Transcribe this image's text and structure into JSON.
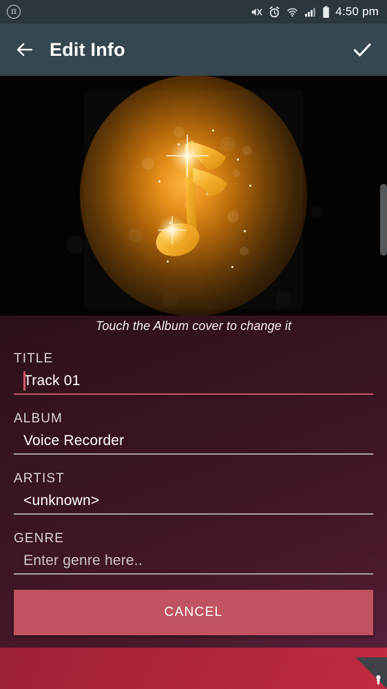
{
  "statusbar": {
    "left_icon": "pi-circle-icon",
    "pi_glyph": "π",
    "icons": [
      "mute-icon",
      "alarm-icon",
      "wifi-icon",
      "signal-icon",
      "battery-icon"
    ],
    "time": "4:50 pm"
  },
  "appbar": {
    "back_icon": "back-arrow-icon",
    "title": "Edit Info",
    "confirm_icon": "checkmark-icon"
  },
  "albumart": {
    "description": "glowing-music-note-album-cover",
    "hint": "Touch the Album cover to change it"
  },
  "form": {
    "fields": [
      {
        "label": "TITLE",
        "value": "Track 01",
        "placeholder": "",
        "focused": true,
        "is_placeholder": false
      },
      {
        "label": "ALBUM",
        "value": "Voice Recorder",
        "placeholder": "",
        "focused": false,
        "is_placeholder": false
      },
      {
        "label": "ARTIST",
        "value": "<unknown>",
        "placeholder": "",
        "focused": false,
        "is_placeholder": false
      },
      {
        "label": "GENRE",
        "value": "Enter genre here..",
        "placeholder": "Enter genre here..",
        "focused": false,
        "is_placeholder": true
      }
    ],
    "cancel_label": "CANCEL"
  },
  "bottombar": {
    "corner_icon": "keyhole-icon"
  },
  "colors": {
    "statusbar": "#2b363d",
    "appbar": "#36474f",
    "panel_dark": "#2d1019",
    "panel_light": "#55203a",
    "accent_focus": "#c9566a",
    "cancel_button": "#bf5361",
    "bottombar": "#ad2539",
    "album_glow": "#e98f18"
  }
}
